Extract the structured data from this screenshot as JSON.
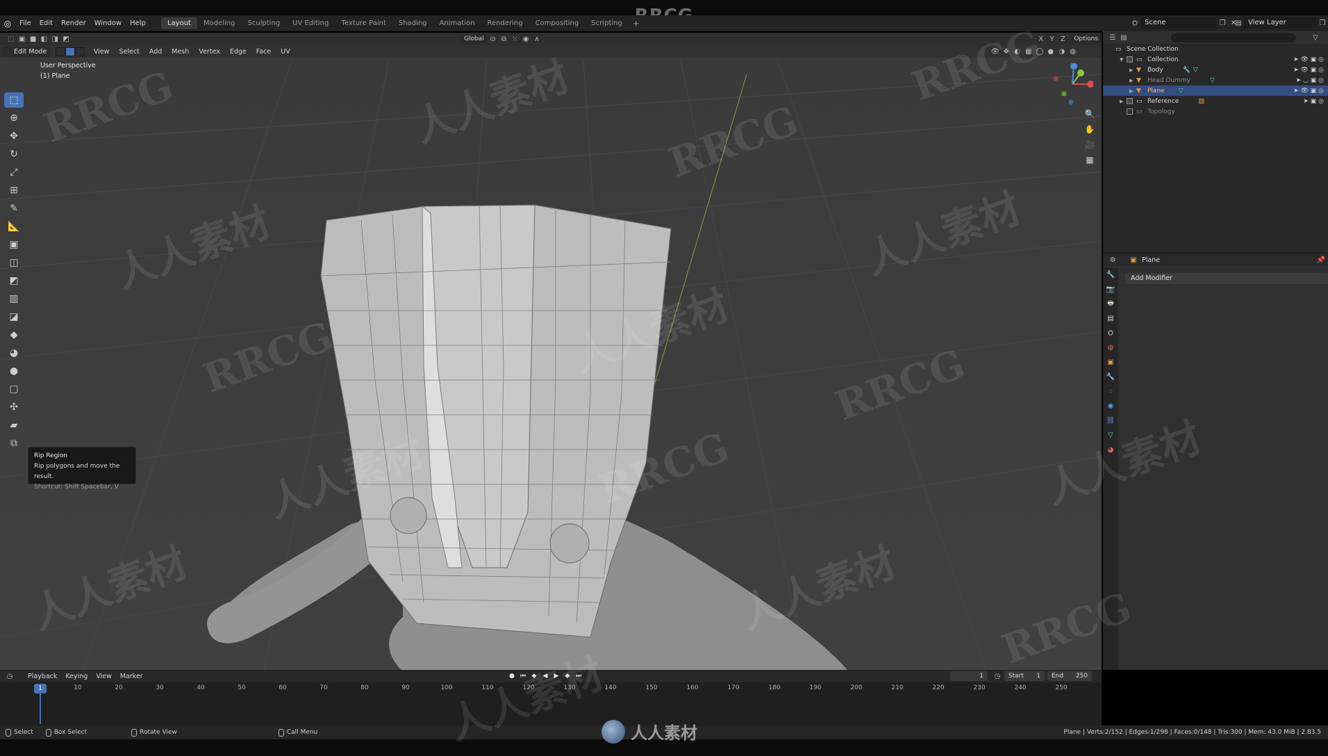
{
  "brand": {
    "top_logo": "RRCG",
    "bottom_logo": "人人素材",
    "watermark_a": "RRCG",
    "watermark_b": "人人素材"
  },
  "menubar": {
    "items": [
      "File",
      "Edit",
      "Render",
      "Window",
      "Help"
    ],
    "workspaces": [
      "Layout",
      "Modeling",
      "Sculpting",
      "UV Editing",
      "Texture Paint",
      "Shading",
      "Animation",
      "Rendering",
      "Compositing",
      "Scripting"
    ],
    "active_workspace": "Layout",
    "add_tab": "+",
    "scene": "Scene",
    "view_layer": "View Layer"
  },
  "viewport_header": {
    "transform_orientation": "Global",
    "options": "Options",
    "axes": [
      "X",
      "Y",
      "Z"
    ],
    "mode": "Edit Mode",
    "menus": [
      "View",
      "Select",
      "Add",
      "Mesh",
      "Vertex",
      "Edge",
      "Face",
      "UV"
    ]
  },
  "viewport_info": {
    "view_name": "User Perspective",
    "object": "(1) Plane"
  },
  "toolbar": {
    "tools": [
      "select-box",
      "cursor",
      "move",
      "rotate",
      "scale",
      "transform",
      "annotate",
      "measure",
      "extrude",
      "inset",
      "bevel",
      "loop-cut",
      "knife",
      "poly-build",
      "spin",
      "smooth",
      "edge-slide",
      "shrink-fatten",
      "shear",
      "rip-region"
    ],
    "active": "select-box"
  },
  "tooltip": {
    "title": "Rip Region",
    "description": "Rip polygons and move the result.",
    "shortcut": "Shortcut: Shift Spacebar, V"
  },
  "gizmo": {
    "x": "X",
    "y": "Y",
    "z": "Z",
    "colors": {
      "x": "#e04850",
      "y": "#8bc43f",
      "z": "#4a8ce0"
    }
  },
  "outliner": {
    "root": "Scene Collection",
    "items": [
      {
        "name": "Collection",
        "kind": "collection",
        "indent": 1
      },
      {
        "name": "Body",
        "kind": "mesh",
        "indent": 2
      },
      {
        "name": "Head Dummy",
        "kind": "mesh",
        "indent": 2,
        "dim": true
      },
      {
        "name": "Plane",
        "kind": "mesh",
        "indent": 2,
        "selected": true
      },
      {
        "name": "Reference",
        "kind": "collection",
        "indent": 1
      },
      {
        "name": "Topology",
        "kind": "collection",
        "indent": 1,
        "dim": true
      }
    ]
  },
  "properties": {
    "object_name": "Plane",
    "add_modifier": "Add Modifier"
  },
  "timeline": {
    "menus": [
      "Playback",
      "Keying",
      "View",
      "Marker"
    ],
    "current_frame": "1",
    "start_label": "Start",
    "start": "1",
    "end_label": "End",
    "end": "250",
    "ruler": [
      "10",
      "20",
      "30",
      "40",
      "50",
      "60",
      "70",
      "80",
      "90",
      "100",
      "110",
      "120",
      "130",
      "140",
      "150",
      "160",
      "170",
      "180",
      "190",
      "200",
      "210",
      "220",
      "230",
      "240",
      "250"
    ],
    "frame_marker": "1"
  },
  "statusbar": {
    "select": "Select",
    "box_select": "Box Select",
    "rotate_view": "Rotate View",
    "call_menu": "Call Menu",
    "stats": "Plane | Verts:2/152 | Edges:1/298 | Faces:0/148 | Tris:300 | Mem: 43.0 MiB | 2.83.5"
  },
  "colors": {
    "accent": "#4772b3",
    "viewport_bg": "#3d3d3d",
    "panel_bg": "#303030",
    "outliner_bg": "#282828"
  }
}
